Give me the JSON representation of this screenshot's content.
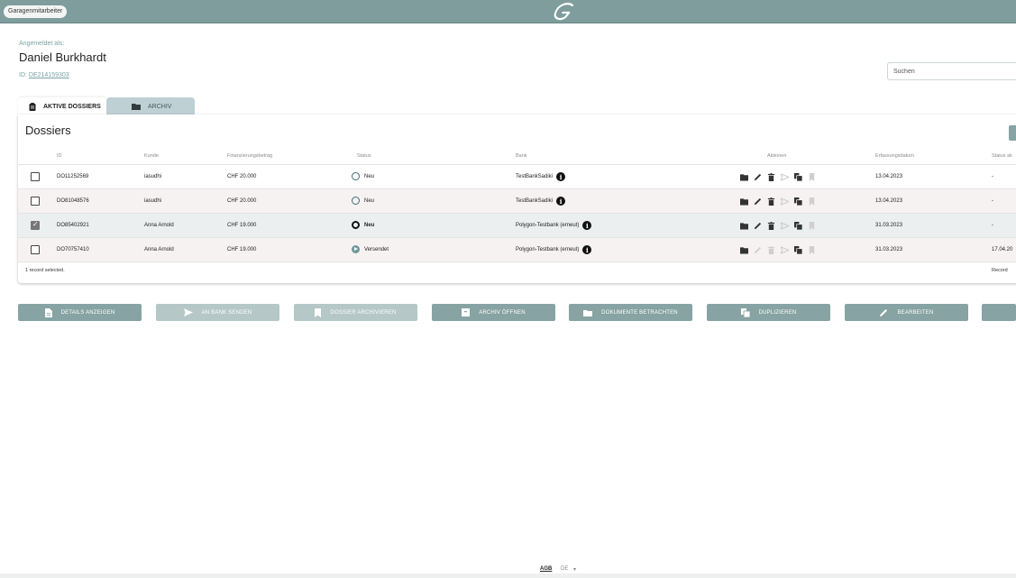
{
  "header": {
    "role_label": "Garagenmitarbeiter",
    "brand_color": "#7e9d9c"
  },
  "user": {
    "logged_in_label": "Angemeldet als:",
    "name": "Daniel Burkhardt",
    "id_prefix": "ID:",
    "id_value": "DE214159303"
  },
  "search": {
    "placeholder": "Suchen",
    "value": ""
  },
  "tabs": [
    {
      "label": "AKTIVE DOSSIERS",
      "icon": "clipboard-icon",
      "active": true
    },
    {
      "label": "ARCHIV",
      "icon": "folder-icon",
      "active": false
    }
  ],
  "table": {
    "title": "Dossiers",
    "columns": [
      "ID",
      "Kunde",
      "Finanzierungsbetrag",
      "Status",
      "Bank",
      "Aktionen",
      "Erfassungsdatum",
      "Status ak"
    ],
    "rows": [
      {
        "id": "DO11252569",
        "kunde": "iasudhi",
        "betrag": "CHF 20.000",
        "status": "Neu",
        "status_style": "ring",
        "bank": "TestBankSadiki",
        "erfassung": "13.04.2023",
        "status_akt": "-",
        "checked": false
      },
      {
        "id": "DO81048576",
        "kunde": "iasudhi",
        "betrag": "CHF 20.000",
        "status": "Neu",
        "status_style": "ring",
        "bank": "TestBankSadiki",
        "erfassung": "13.04.2023",
        "status_akt": "-",
        "checked": false
      },
      {
        "id": "DO85402921",
        "kunde": "Anna Arnold",
        "betrag": "CHF 19.000",
        "status": "Neu",
        "status_style": "ring-bold",
        "bank": "Polygon-Testbank (erneut)",
        "erfassung": "31.03.2023",
        "status_akt": "-",
        "checked": true
      },
      {
        "id": "DO70757410",
        "kunde": "Anna Arnold",
        "betrag": "CHF 19.000",
        "status": "Versendet",
        "status_style": "sent",
        "bank": "Polygon-Testbank (erneut)",
        "erfassung": "31.03.2023",
        "status_akt": "17.04.20",
        "checked": false
      }
    ],
    "selection_text": "1 record selected.",
    "footer_right": "Record"
  },
  "buttons": [
    {
      "label": "DETAILS ANZEIGEN",
      "icon": "document-icon",
      "disabled": false
    },
    {
      "label": "AN BANK SENDEN",
      "icon": "send-icon",
      "disabled": true
    },
    {
      "label": "DOSSIER ARCHIVIEREN",
      "icon": "bookmark-icon",
      "disabled": true
    },
    {
      "label": "ARCHIV ÖFFNEN",
      "icon": "archive-box-icon",
      "disabled": false
    },
    {
      "label": "DOKUMENTE BETRACHTEN",
      "icon": "folder-icon",
      "disabled": false
    },
    {
      "label": "DUPLIZIEREN",
      "icon": "copy-icon",
      "disabled": false
    },
    {
      "label": "BEARBEITEN",
      "icon": "pencil-icon",
      "disabled": false
    }
  ],
  "footer": {
    "agb": "AGB",
    "language": "DE"
  }
}
